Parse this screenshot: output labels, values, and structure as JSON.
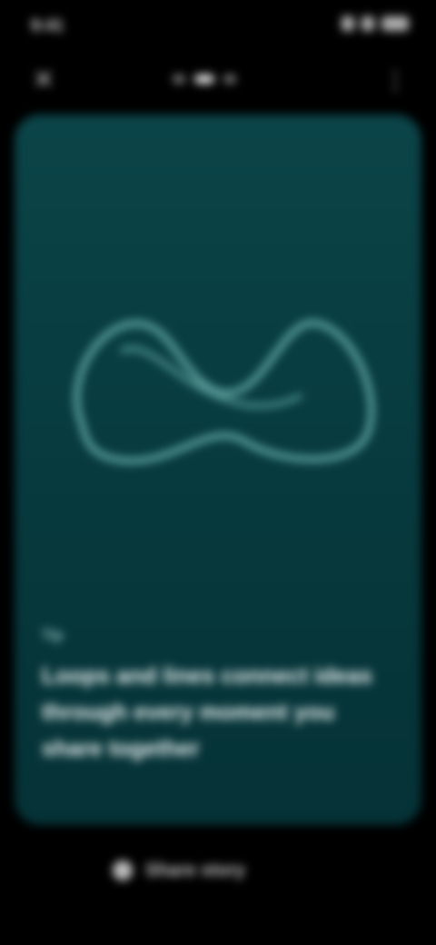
{
  "status_bar": {
    "time": "9:41",
    "icons": [
      "signal-icon",
      "wifi-icon",
      "battery-icon"
    ]
  },
  "top_bar": {
    "close_icon": "close-icon",
    "more_icon": "more-icon",
    "progress": {
      "total": 3,
      "current": 2
    }
  },
  "card": {
    "background": "#0b4448",
    "illustration_icon": "infinity-loop-icon",
    "caption_label": "Tip",
    "caption_text": "Loops and lines connect ideas through every moment you share together"
  },
  "bottom_bar": {
    "share_label": "Share story"
  }
}
